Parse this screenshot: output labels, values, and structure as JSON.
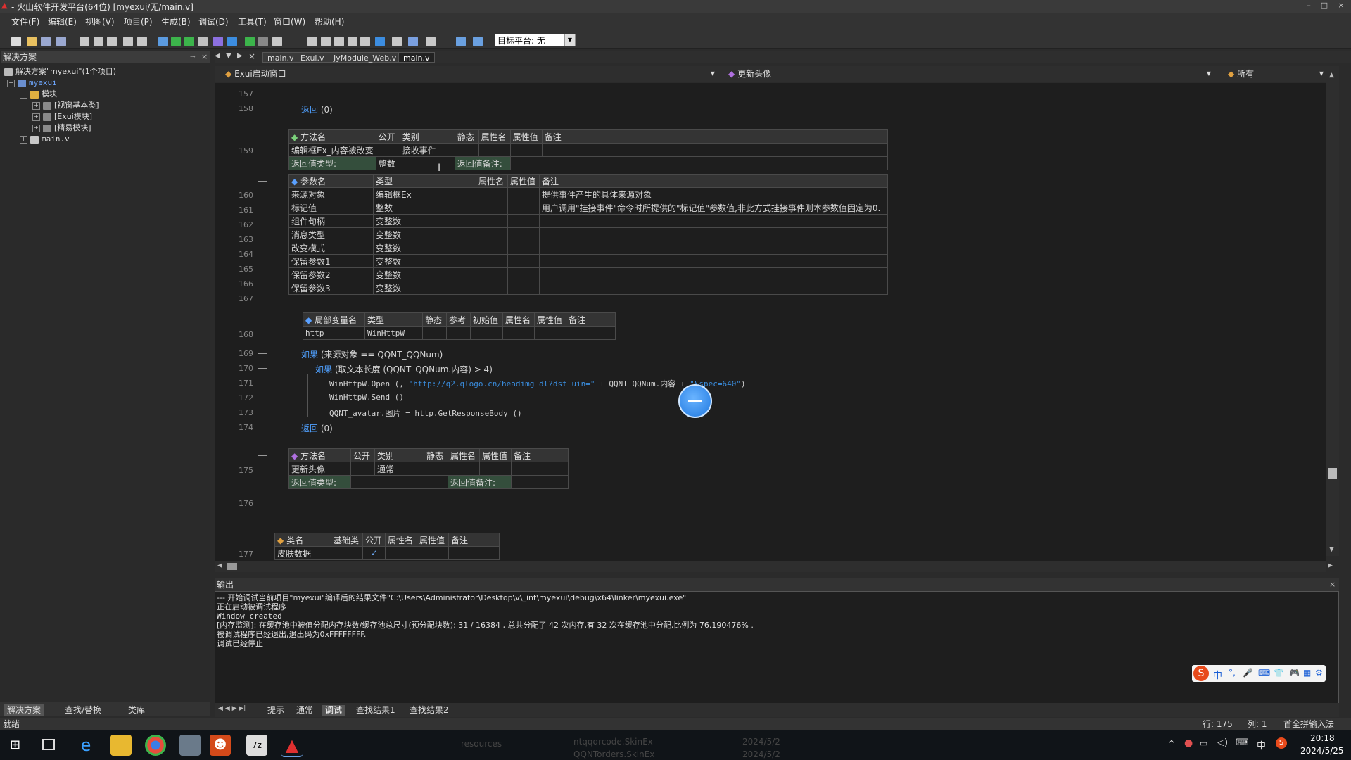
{
  "window": {
    "title": "- 火山软件开发平台(64位) [myexui/无/main.v]",
    "controls": [
      "–",
      "□",
      "×"
    ]
  },
  "menu": [
    "文件(F)",
    "编辑(E)",
    "视图(V)",
    "项目(P)",
    "生成(B)",
    "调试(D)",
    "工具(T)",
    "窗口(W)",
    "帮助(H)"
  ],
  "toolbar": {
    "platform_label": "目标平台: 无",
    "icon_colors": [
      "#dcdcdc",
      "#e8c060",
      "#9aa8d0",
      "#9aa8d0",
      "#c8c8c8",
      "#c8c8c8",
      "#c8c8c8",
      "#c8c8c8",
      "#c8c8c8",
      "#5b9be0",
      "#3cb44b",
      "#3cb44b",
      "#c0c0c0",
      "#8c70e0",
      "#3c8de0",
      "#3cb44b",
      "#888888",
      "#c8c8c8",
      "#c8c8c8",
      "#c8c8c8",
      "#c8c8c8",
      "#c8c8c8",
      "#c8c8c8",
      "#3c8de0",
      "#c8c8c8",
      "#7aa0e0",
      "#c8c8c8",
      "#6aa0e0",
      "#6aa0e0"
    ]
  },
  "solution": {
    "panel_title": "解决方案",
    "root": "解决方案\"myexui\"(1个项目)",
    "project": "myexui",
    "module_folder": "模块",
    "modules": [
      "[视窗基本类]",
      "[Exui模块]",
      "[精易模块]"
    ],
    "file": "main.v",
    "tabs": [
      "解决方案",
      "查找/替换",
      "类库"
    ]
  },
  "editor_tabs": [
    "main.v",
    "Exui.v",
    "JyModule_Web.v",
    "main.v"
  ],
  "navbar": {
    "left": "Exui启动窗口",
    "middle": "更新头像",
    "right": "所有"
  },
  "code": {
    "line_numbers": {
      "l157": "157",
      "l158": "158",
      "l159": "159",
      "l160": "160",
      "l161": "161",
      "l162": "162",
      "l163": "163",
      "l164": "164",
      "l165": "165",
      "l166": "166",
      "l167": "167",
      "l168": "168",
      "l169": "169",
      "l170": "170",
      "l171": "171",
      "l172": "172",
      "l173": "173",
      "l174": "174",
      "l175": "175",
      "l176": "176",
      "l177": "177"
    },
    "return1_kw": "返回",
    "return1_val": "(0)",
    "method1": {
      "headers": [
        "方法名",
        "公开",
        "类别",
        "静态",
        "属性名",
        "属性值",
        "备注"
      ],
      "name": "编辑框Ex_内容被改变",
      "category": "接收事件",
      "ret_type_label": "返回值类型:",
      "ret_type": "整数",
      "ret_note_label": "返回值备注:"
    },
    "params": {
      "headers": [
        "参数名",
        "类型",
        "属性名",
        "属性值",
        "备注"
      ],
      "rows": [
        {
          "name": "来源对象",
          "type": "编辑框Ex",
          "note": "提供事件产生的具体来源对象"
        },
        {
          "name": "标记值",
          "type": "整数",
          "note": "用户调用\"挂接事件\"命令时所提供的\"标记值\"参数值,非此方式挂接事件则本参数值固定为0."
        },
        {
          "name": "组件句柄",
          "type": "变整数",
          "note": ""
        },
        {
          "name": "消息类型",
          "type": "变整数",
          "note": ""
        },
        {
          "name": "改变模式",
          "type": "变整数",
          "note": ""
        },
        {
          "name": "保留参数1",
          "type": "变整数",
          "note": ""
        },
        {
          "name": "保留参数2",
          "type": "变整数",
          "note": ""
        },
        {
          "name": "保留参数3",
          "type": "变整数",
          "note": ""
        }
      ]
    },
    "locals": {
      "headers": [
        "局部变量名",
        "类型",
        "静态",
        "参考",
        "初始值",
        "属性名",
        "属性值",
        "备注"
      ],
      "name": "http",
      "type": "WinHttpW"
    },
    "l169_kw": "如果",
    "l169_rest": "(来源对象 == QQNT_QQNum)",
    "l170_kw": "如果",
    "l170_rest": "(取文本长度 (QQNT_QQNum.内容) > 4)",
    "l171_a": "WinHttpW.Open (, ",
    "l171_str": "\"http://q2.qlogo.cn/headimg_dl?dst_uin=\"",
    "l171_b": " + QQNT_QQNum.内容 + ",
    "l171_str2": "\"&spec=640\"",
    "l171_c": ")",
    "l172": "WinHttpW.Send ()",
    "l173": "QQNT_avatar.图片 = http.GetResponseBody ()",
    "return2_kw": "返回",
    "return2_val": "(0)",
    "method2": {
      "headers": [
        "方法名",
        "公开",
        "类别",
        "静态",
        "属性名",
        "属性值",
        "备注"
      ],
      "name": "更新头像",
      "category": "通常",
      "ret_type_label": "返回值类型:",
      "ret_note_label": "返回值备注:"
    },
    "class_table": {
      "headers": [
        "类名",
        "基础类",
        "公开",
        "属性名",
        "属性值",
        "备注"
      ],
      "name": "皮肤数据",
      "public_mark": "✓"
    }
  },
  "output": {
    "title": "输出",
    "lines": [
      "--- 开始调试当前项目\"myexui\"编译后的结果文件\"C:\\Users\\Administrator\\Desktop\\v\\_int\\myexui\\debug\\x64\\linker\\myexui.exe\"",
      "正在启动被调试程序",
      "Window created",
      "[内存监测]: 在缓存池中被值分配内存块数/缓存池总尺寸(预分配块数): 31 / 16384 , 总共分配了 42 次内存,有 32 次在缓存池中分配,比例为 76.190476% .",
      "被调试程序已经退出,退出码为0xFFFFFFFF.",
      "调试已经停止"
    ],
    "tabs": [
      "提示",
      "通常",
      "调试",
      "查找结果1",
      "查找结果2"
    ],
    "active_tab": "调试"
  },
  "status": {
    "left": "就绪",
    "row": "行: 175",
    "col": "列: 1",
    "ime": "首全拼输入法"
  },
  "taskbar": {
    "time": "20:18",
    "date": "2024/5/25",
    "ime_char": "中",
    "bg_items": [
      "resources",
      "ntqqqrcode.SkinEx",
      "2024/5/2",
      "QQNTorders.SkinEx",
      "2024/5/2"
    ]
  },
  "ime_toolbar": [
    "中",
    "°,",
    "🎤",
    "⌨",
    "👕",
    "🎮",
    "▦",
    "⚙"
  ]
}
